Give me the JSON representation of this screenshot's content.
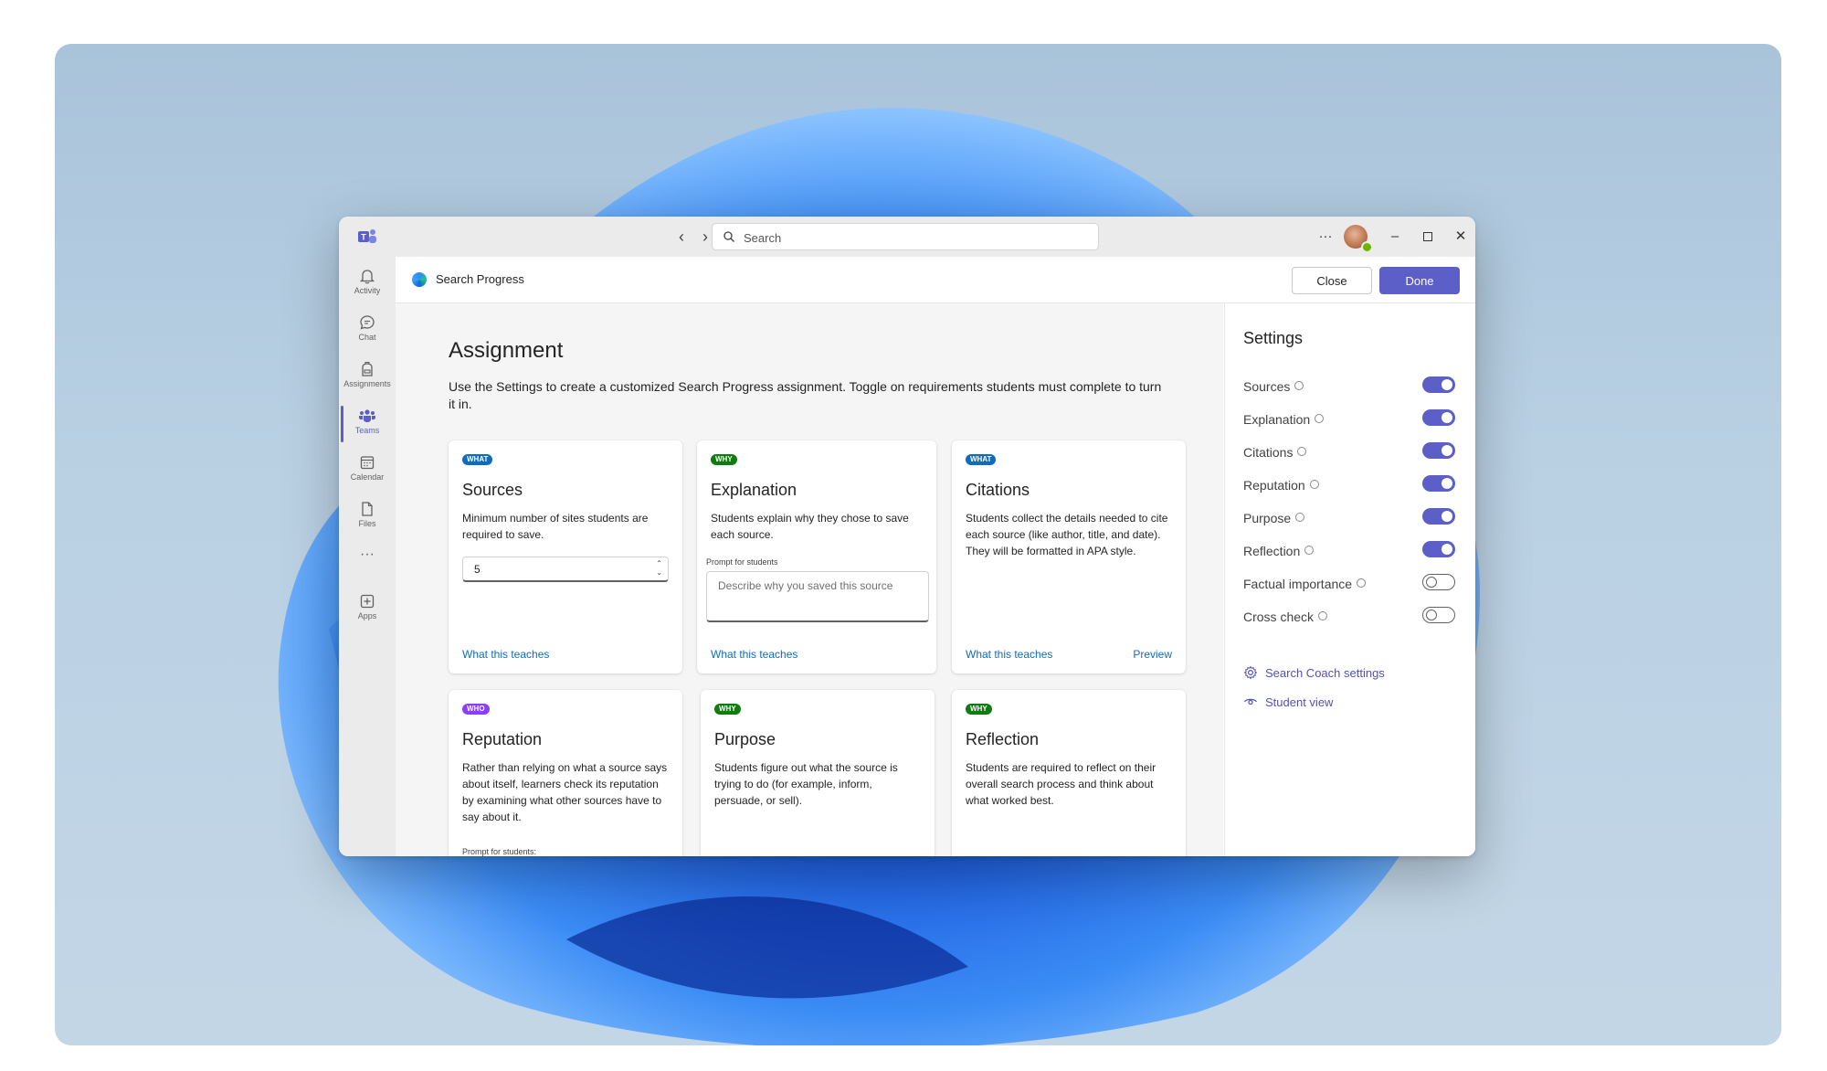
{
  "search": {
    "placeholder": "Search"
  },
  "rail": [
    {
      "label": "Activity",
      "icon": "bell-icon"
    },
    {
      "label": "Chat",
      "icon": "chat-icon"
    },
    {
      "label": "Assignments",
      "icon": "backpack-icon"
    },
    {
      "label": "Teams",
      "icon": "teams-icon",
      "active": true
    },
    {
      "label": "Calendar",
      "icon": "calendar-icon"
    },
    {
      "label": "Files",
      "icon": "file-icon"
    },
    {
      "label": "Apps",
      "icon": "add-app-icon"
    }
  ],
  "app": {
    "title": "Search Progress"
  },
  "buttons": {
    "close": "Close",
    "done": "Done"
  },
  "assignment": {
    "title": "Assignment",
    "description": "Use the Settings to create a customized Search Progress assignment. Toggle on requirements students must complete to turn it in."
  },
  "cards": [
    {
      "tag": "WHAT",
      "title": "Sources",
      "desc": "Minimum number of sites students are required to save.",
      "stepper_value": "5",
      "link": "What this teaches"
    },
    {
      "tag": "WHY",
      "title": "Explanation",
      "desc": "Students explain why they chose to save each source.",
      "prompt_label": "Prompt for students",
      "prompt_placeholder": "Describe why you saved this source",
      "link": "What this teaches"
    },
    {
      "tag": "WHAT",
      "title": "Citations",
      "desc": "Students collect the details needed to cite each source (like author, title, and date). They will be formatted in APA style.",
      "link": "What this teaches",
      "link2": "Preview"
    },
    {
      "tag": "WHO",
      "title": "Reputation",
      "desc": "Rather than relying on what a source says about itself, learners check its reputation by examining what other sources have to say about it.",
      "prompt_label": "Prompt for students:"
    },
    {
      "tag": "WHY",
      "title": "Purpose",
      "desc": "Students figure out what the source is trying to do (for example, inform, persuade, or sell)."
    },
    {
      "tag": "WHY",
      "title": "Reflection",
      "desc": "Students are required to reflect on their overall search process and think about what worked best."
    }
  ],
  "settings": {
    "title": "Settings",
    "items": [
      {
        "label": "Sources",
        "on": true
      },
      {
        "label": "Explanation",
        "on": true
      },
      {
        "label": "Citations",
        "on": true
      },
      {
        "label": "Reputation",
        "on": true
      },
      {
        "label": "Purpose",
        "on": true
      },
      {
        "label": "Reflection",
        "on": true
      },
      {
        "label": "Factual importance",
        "on": false
      },
      {
        "label": "Cross check",
        "on": false
      }
    ],
    "links": {
      "coach": "Search Coach settings",
      "student": "Student view"
    }
  },
  "colors": {
    "accent": "#5b5fc7",
    "link": "#0f6cbd",
    "what": "#0f6cbd",
    "why": "#107c10",
    "who": "#8a3ffc"
  }
}
